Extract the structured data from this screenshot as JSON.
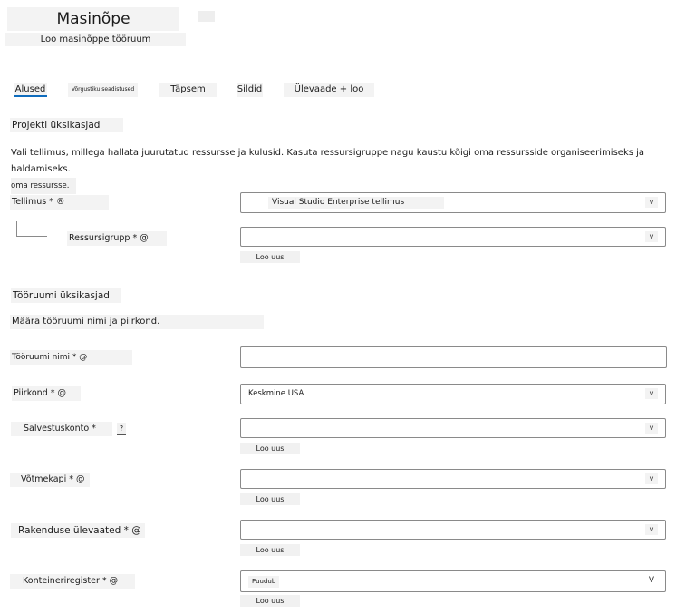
{
  "header": {
    "title": "Masinõpe",
    "subtitle": "Loo masinõppe tööruum"
  },
  "tabs": [
    {
      "label": "Alused"
    },
    {
      "label": "Võrgustiku seadistused"
    },
    {
      "label": "Täpsem"
    },
    {
      "label": "Sildid"
    },
    {
      "label": "Ülevaade + loo"
    }
  ],
  "project": {
    "section_title": "Projekti üksikasjad",
    "description_line1": "Vali tellimus, millega hallata juurutatud ressursse ja kulusid. Kasuta ressursigruppe nagu kaustu kõigi oma ressursside organiseerimiseks ja haldamiseks.",
    "description_line2": "oma ressursse.",
    "subscription_label": "Tellimus * ®",
    "subscription_value": "Visual Studio Enterprise tellimus",
    "resource_group_label": "Ressursigrupp * @",
    "resource_group_value": "",
    "create_new": "Loo uus"
  },
  "workspace": {
    "section_title": "Tööruumi üksikasjad",
    "description": "Määra tööruumi nimi ja piirkond.",
    "name_label": "Tööruumi nimi * @",
    "name_value": "",
    "region_label": "Piirkond * @",
    "region_value": "Keskmine USA",
    "storage_label": "Salvestuskonto *",
    "storage_help": "?",
    "storage_value": "",
    "keyvault_label": "Võtmekapi * @",
    "keyvault_value": "",
    "appinsights_label": "Rakenduse ülevaated * @",
    "appinsights_value": "",
    "registry_label": "Konteineriregister * @",
    "registry_value": "Puudub",
    "create_new": "Loo uus"
  },
  "icons": {
    "dropdown": "chevron-down-icon",
    "dropdown_glyph": "v",
    "dropdown_glyph_upper": "V"
  }
}
